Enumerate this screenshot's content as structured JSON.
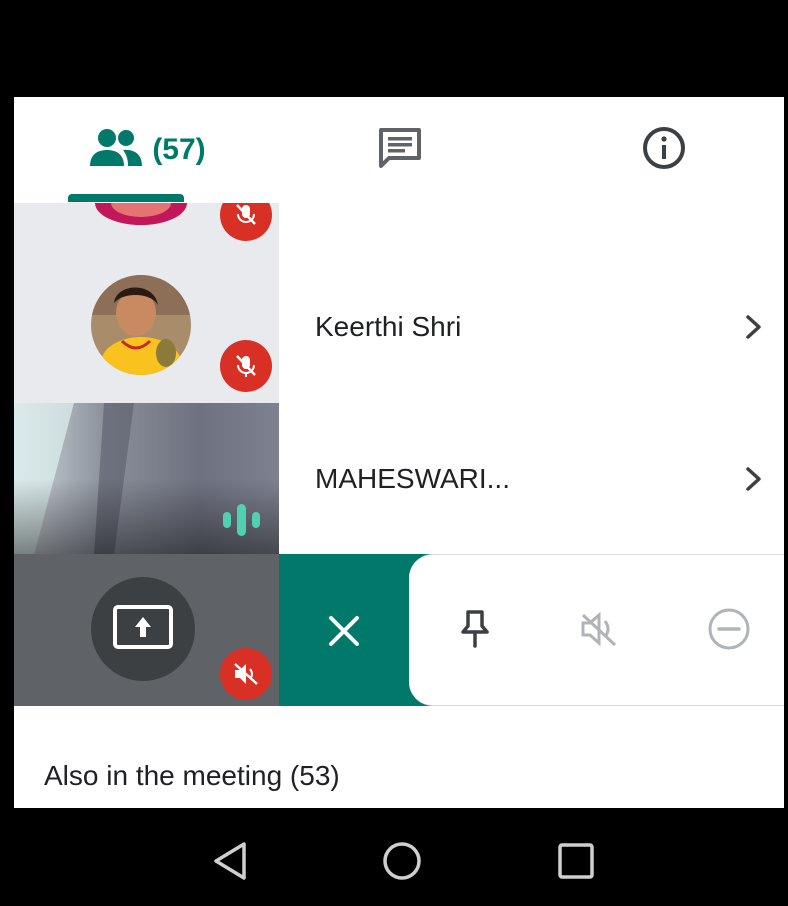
{
  "tabs": [
    {
      "icon": "people-icon",
      "count_label": "(57)",
      "selected": true
    },
    {
      "icon": "chat-icon"
    },
    {
      "icon": "info-icon"
    }
  ],
  "participants": [
    {
      "name": "Keerthi Shri",
      "muted": true
    },
    {
      "name": "MAHESWARI...",
      "speaking": true
    }
  ],
  "presenting_tile": {
    "icon": "present-screen-icon",
    "badge": "volume-off-icon"
  },
  "actions": [
    "close-icon",
    "pin-icon",
    "mute-audio-icon",
    "remove-icon"
  ],
  "section_title": "Also in the meeting (53)",
  "nav": [
    "back-icon",
    "home-icon",
    "recents-icon"
  ],
  "colors": {
    "accent": "#00796b",
    "mute_red": "#d93025",
    "tile_grey": "#5f6368"
  }
}
